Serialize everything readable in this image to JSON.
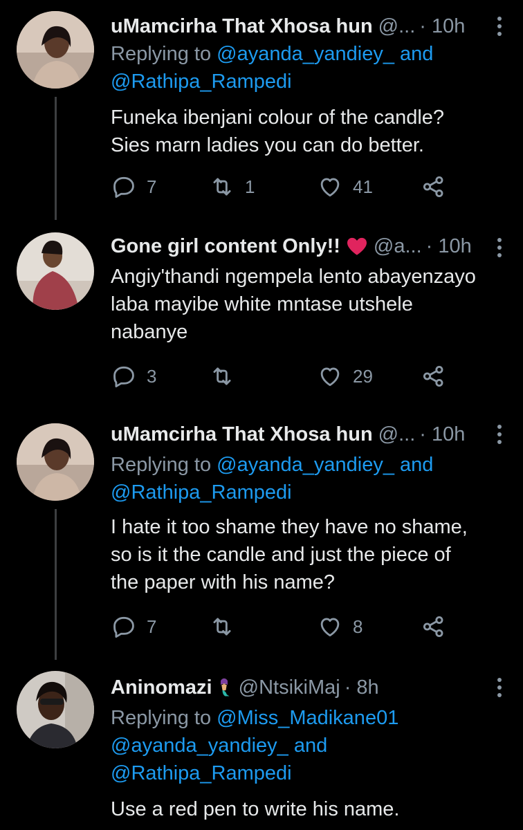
{
  "tweets": [
    {
      "name": "uMamcirha That Xhosa hun",
      "handle": "@...",
      "time": "· 10h",
      "replying_prefix": "Replying to",
      "replying_user1": "@ayanda_yandiey_",
      "replying_and": "and",
      "replying_user2": "@Rathipa_Rampedi",
      "body_lines": [
        "Funeka ibenjani colour of the candle?",
        "Sies marn ladies you can do better."
      ],
      "replies": "7",
      "retweets": "1",
      "likes": "41"
    },
    {
      "name": "Gone girl content Only!!",
      "handle": "@a...",
      "time": "· 10h",
      "body_lines": [
        "Angiy'thandi ngempela lento abayenzayo",
        "laba mayibe white mntase utshele",
        "nabanye"
      ],
      "replies": "3",
      "retweets": "",
      "likes": "29"
    },
    {
      "name": "uMamcirha That Xhosa hun",
      "handle": "@...",
      "time": "· 10h",
      "replying_prefix": "Replying to",
      "replying_user1": "@ayanda_yandiey_",
      "replying_and": "and",
      "replying_user2": "@Rathipa_Rampedi",
      "body_lines": [
        "I hate it too shame they have no shame,",
        "so is it the candle and just the piece of",
        "the paper with his name?"
      ],
      "replies": "7",
      "retweets": "",
      "likes": "8"
    },
    {
      "name": "Aninomazi",
      "handle": "@NtsikiMaj",
      "time": "· 8h",
      "replying_prefix": "Replying to",
      "replying_user0": "@Miss_Madikane01",
      "replying_user1": "@ayanda_yandiey_",
      "replying_and": "and",
      "replying_user2": "@Rathipa_Rampedi",
      "body_lines": [
        "Use a red pen to write his name."
      ]
    }
  ],
  "icons": {
    "reply": "reply-icon",
    "retweet": "retweet-icon",
    "like": "like-icon",
    "share": "share-icon",
    "more": "more-options-icon"
  },
  "colors": {
    "background": "#000000",
    "text": "#e7e9ea",
    "muted": "#8b98a5",
    "link": "#1d9bf0",
    "heart_emoji": "#e0245e"
  }
}
